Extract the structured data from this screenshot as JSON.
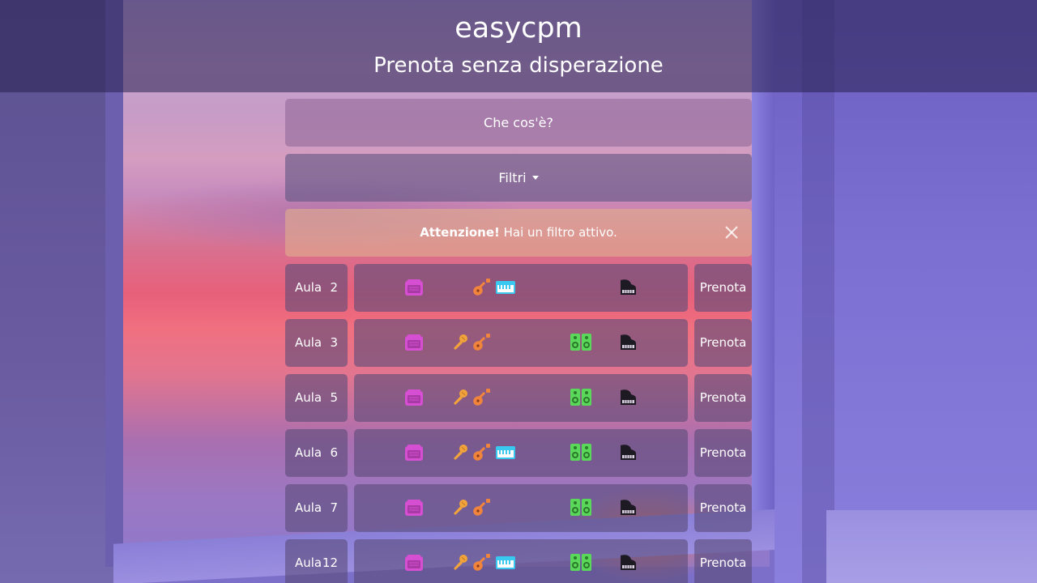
{
  "header": {
    "brand": "easycpm",
    "tagline": "Prenota senza disperazione"
  },
  "what_button": {
    "label": "Che cos'è?"
  },
  "filter_button": {
    "label": "Filtri"
  },
  "alert": {
    "strong": "Attenzione!",
    "message": " Hai un filtro attivo."
  },
  "colors": {
    "amp": "#d64fd2",
    "mic": "#f2a43a",
    "guitar": "#f0843c",
    "keys": "#38c8f0",
    "speakers": "#5ad85a",
    "piano": "#1e1a24"
  },
  "rooms": [
    {
      "label": "Aula",
      "number": "2",
      "book_label": "Prenota",
      "equipment": [
        "amp-icon",
        "guitar-icon",
        "keyboard-icon",
        "piano-icon"
      ]
    },
    {
      "label": "Aula",
      "number": "3",
      "book_label": "Prenota",
      "equipment": [
        "amp-icon",
        "microphone-icon",
        "guitar-icon",
        "speakers-icon",
        "piano-icon"
      ]
    },
    {
      "label": "Aula",
      "number": "5",
      "book_label": "Prenota",
      "equipment": [
        "amp-icon",
        "microphone-icon",
        "guitar-icon",
        "speakers-icon",
        "piano-icon"
      ]
    },
    {
      "label": "Aula",
      "number": "6",
      "book_label": "Prenota",
      "equipment": [
        "amp-icon",
        "microphone-icon",
        "guitar-icon",
        "keyboard-icon",
        "speakers-icon",
        "piano-icon"
      ]
    },
    {
      "label": "Aula",
      "number": "7",
      "book_label": "Prenota",
      "equipment": [
        "amp-icon",
        "microphone-icon",
        "guitar-icon",
        "speakers-icon",
        "piano-icon"
      ]
    },
    {
      "label": "Aula",
      "number": "12",
      "book_label": "Prenota",
      "equipment": [
        "amp-icon",
        "microphone-icon",
        "guitar-icon",
        "keyboard-icon",
        "speakers-icon",
        "piano-icon"
      ]
    }
  ]
}
